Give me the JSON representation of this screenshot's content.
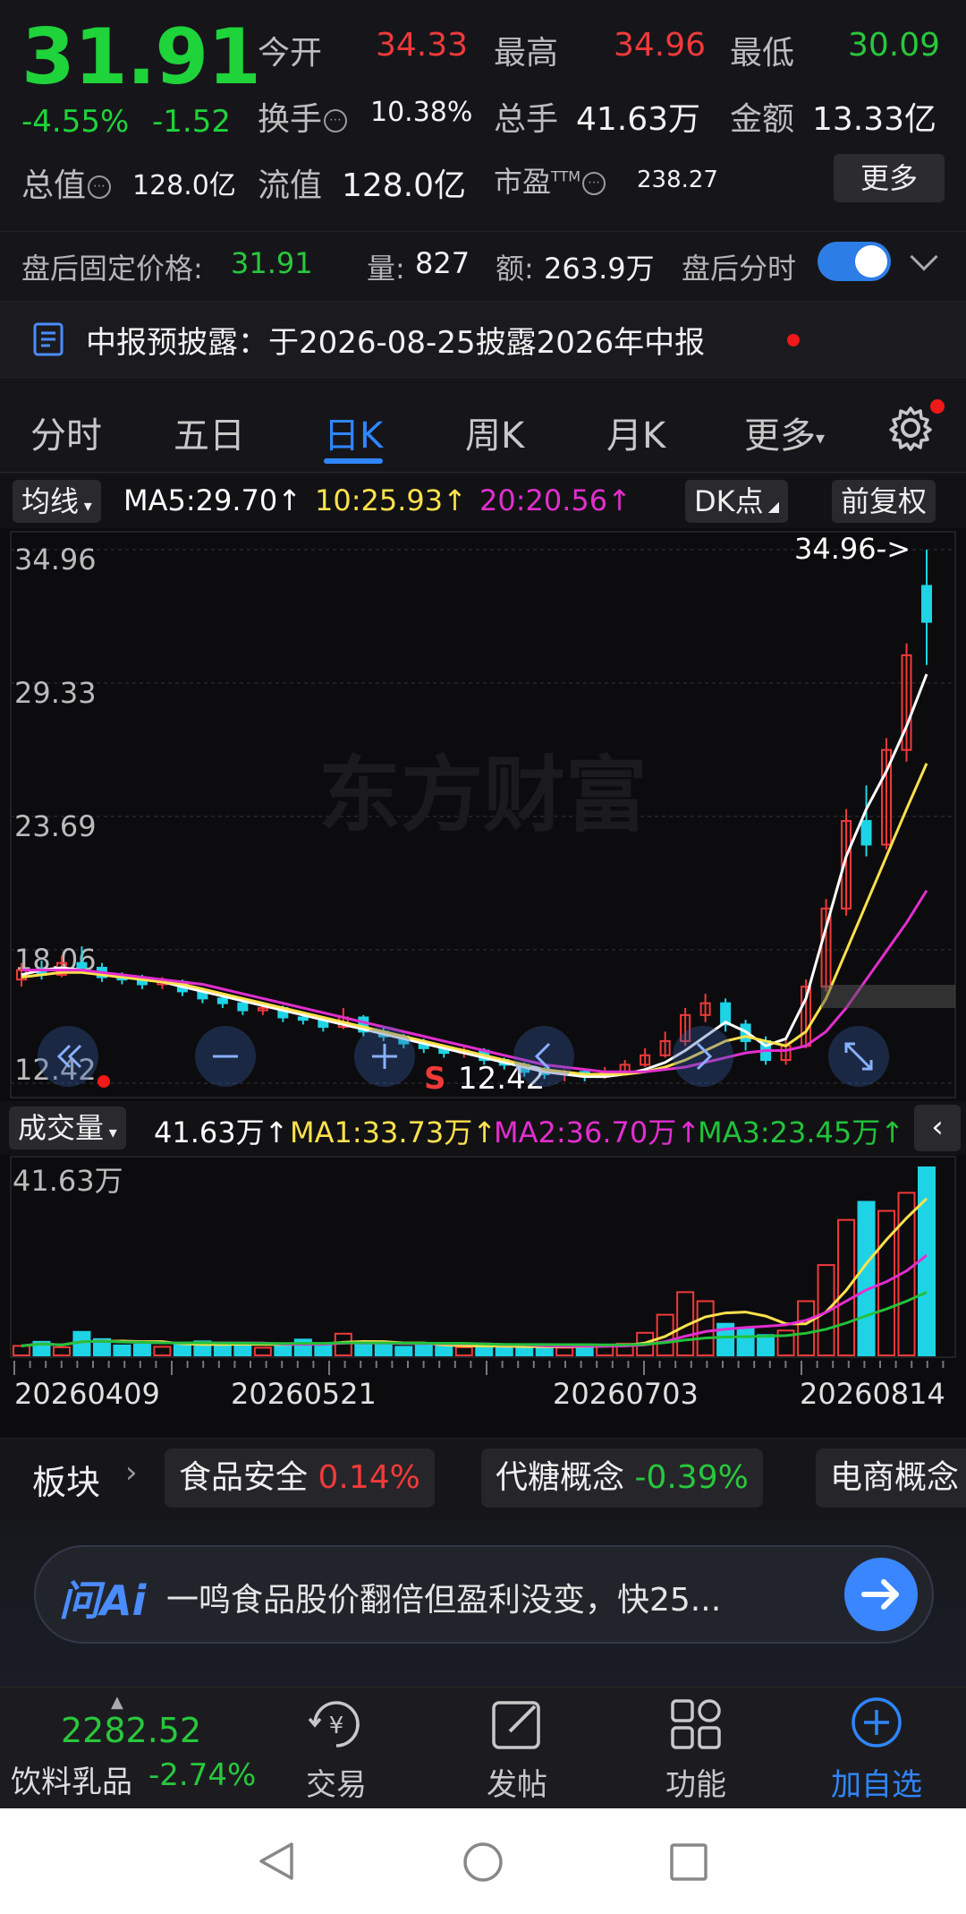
{
  "quote": {
    "price": "31.91",
    "change_pct": "-4.55%",
    "change_abs": "-1.52",
    "open_label": "今开",
    "open_value": "34.33",
    "high_label": "最高",
    "high_value": "34.96",
    "low_label": "最低",
    "low_value": "30.09",
    "turnover_label": "换手",
    "turnover_value": "10.38%",
    "volume_label": "总手",
    "volume_value": "41.63万",
    "amount_label": "金额",
    "amount_value": "13.33亿",
    "mktcap_label": "总值",
    "mktcap_value": "128.0亿",
    "float_label": "流值",
    "float_value": "128.0亿",
    "pe_label": "市盈",
    "pe_super": "TTM",
    "pe_value": "238.27",
    "more_label": "更多"
  },
  "after_hours": {
    "fixed_label": "盘后固定价格:",
    "fixed_value": "31.91",
    "vol_label": "量:",
    "vol_value": "827",
    "amt_label": "额:",
    "amt_value": "263.9万",
    "timeshare_label": "盘后分时",
    "toggle_on": true
  },
  "notice": {
    "text": "中报预披露：于2026-08-25披露2026年中报"
  },
  "tabs": [
    {
      "label": "分时",
      "active": false
    },
    {
      "label": "五日",
      "active": false
    },
    {
      "label": "日K",
      "active": true
    },
    {
      "label": "周K",
      "active": false
    },
    {
      "label": "月K",
      "active": false
    },
    {
      "label": "更多",
      "active": false
    }
  ],
  "ma_header": {
    "selector": "均线",
    "ma5": "MA5:29.70↑",
    "ma10": "10:25.93↑",
    "ma20": "20:20.56↑",
    "dk": "DK点",
    "adjust": "前复权"
  },
  "colors": {
    "up": "#f03a3a",
    "down": "#1fd3e6",
    "ma5": "#ffffff",
    "ma10": "#ffe14d",
    "ma20": "#e22ed0",
    "accent": "#2f86ff"
  },
  "chart_data": [
    {
      "type": "candlestick",
      "y_ticks": [
        "34.96",
        "29.33",
        "23.69",
        "18.06",
        "12.42"
      ],
      "ylim": [
        12.42,
        34.96
      ],
      "max_label": "34.96->",
      "min_label": "12.42",
      "signal_label": "S",
      "watermark": "东方财富",
      "series": [
        {
          "name": "MA5",
          "values": [
            17.0,
            17.2,
            17.3,
            17.2,
            17.0,
            16.9,
            16.8,
            16.7,
            16.5,
            16.3,
            16.1,
            15.9,
            15.7,
            15.5,
            15.3,
            15.1,
            14.9,
            14.7,
            14.5,
            14.3,
            14.1,
            13.9,
            13.7,
            13.5,
            13.3,
            13.1,
            12.9,
            12.8,
            12.7,
            12.7,
            12.8,
            13.0,
            13.3,
            13.8,
            14.4,
            15.0,
            14.6,
            14.0,
            14.3,
            16.0,
            19.0,
            22.0,
            24.0,
            25.6,
            27.5,
            29.7
          ]
        },
        {
          "name": "MA10",
          "values": [
            16.9,
            17.0,
            17.1,
            17.1,
            17.0,
            16.9,
            16.8,
            16.7,
            16.6,
            16.4,
            16.2,
            16.0,
            15.8,
            15.6,
            15.4,
            15.2,
            15.0,
            14.8,
            14.6,
            14.4,
            14.2,
            14.0,
            13.8,
            13.6,
            13.4,
            13.2,
            13.0,
            12.9,
            12.8,
            12.8,
            12.8,
            12.9,
            13.1,
            13.4,
            13.8,
            14.2,
            14.4,
            14.2,
            14.0,
            14.6,
            16.0,
            18.0,
            20.0,
            22.0,
            24.0,
            25.93
          ]
        },
        {
          "name": "MA20",
          "values": [
            17.2,
            17.2,
            17.2,
            17.2,
            17.1,
            17.0,
            16.9,
            16.8,
            16.7,
            16.6,
            16.4,
            16.2,
            16.0,
            15.8,
            15.6,
            15.4,
            15.2,
            15.0,
            14.8,
            14.6,
            14.4,
            14.2,
            14.0,
            13.8,
            13.6,
            13.4,
            13.2,
            13.1,
            13.0,
            12.9,
            12.9,
            12.9,
            13.0,
            13.1,
            13.3,
            13.5,
            13.7,
            13.8,
            13.8,
            14.0,
            14.6,
            15.6,
            16.8,
            18.0,
            19.2,
            20.56
          ]
        }
      ],
      "candles": [
        {
          "o": 16.8,
          "c": 17.2,
          "h": 17.5,
          "l": 16.5
        },
        {
          "o": 17.2,
          "c": 17.0,
          "h": 17.6,
          "l": 16.8
        },
        {
          "o": 17.0,
          "c": 17.5,
          "h": 17.8,
          "l": 16.9
        },
        {
          "o": 17.5,
          "c": 17.3,
          "h": 18.2,
          "l": 17.1
        },
        {
          "o": 17.3,
          "c": 16.9,
          "h": 17.5,
          "l": 16.7
        },
        {
          "o": 16.9,
          "c": 16.8,
          "h": 17.1,
          "l": 16.6
        },
        {
          "o": 16.8,
          "c": 16.6,
          "h": 17.0,
          "l": 16.4
        },
        {
          "o": 16.6,
          "c": 16.7,
          "h": 16.9,
          "l": 16.4
        },
        {
          "o": 16.7,
          "c": 16.3,
          "h": 16.8,
          "l": 16.1
        },
        {
          "o": 16.3,
          "c": 16.0,
          "h": 16.4,
          "l": 15.8
        },
        {
          "o": 16.0,
          "c": 15.8,
          "h": 16.2,
          "l": 15.6
        },
        {
          "o": 15.8,
          "c": 15.5,
          "h": 15.9,
          "l": 15.3
        },
        {
          "o": 15.5,
          "c": 15.6,
          "h": 15.8,
          "l": 15.3
        },
        {
          "o": 15.6,
          "c": 15.2,
          "h": 15.7,
          "l": 15.0
        },
        {
          "o": 15.2,
          "c": 15.1,
          "h": 15.4,
          "l": 14.9
        },
        {
          "o": 15.1,
          "c": 14.8,
          "h": 15.2,
          "l": 14.6
        },
        {
          "o": 14.8,
          "c": 15.2,
          "h": 15.6,
          "l": 14.7
        },
        {
          "o": 15.2,
          "c": 14.6,
          "h": 15.3,
          "l": 14.4
        },
        {
          "o": 14.6,
          "c": 14.4,
          "h": 14.8,
          "l": 14.2
        },
        {
          "o": 14.4,
          "c": 14.1,
          "h": 14.5,
          "l": 13.9
        },
        {
          "o": 14.1,
          "c": 13.9,
          "h": 14.3,
          "l": 13.7
        },
        {
          "o": 13.9,
          "c": 13.7,
          "h": 14.0,
          "l": 13.5
        },
        {
          "o": 13.7,
          "c": 13.8,
          "h": 14.0,
          "l": 13.5
        },
        {
          "o": 13.8,
          "c": 13.4,
          "h": 13.9,
          "l": 13.2
        },
        {
          "o": 13.4,
          "c": 13.2,
          "h": 13.5,
          "l": 13.0
        },
        {
          "o": 13.2,
          "c": 12.9,
          "h": 13.3,
          "l": 12.7
        },
        {
          "o": 12.9,
          "c": 12.8,
          "h": 13.1,
          "l": 12.6
        },
        {
          "o": 12.8,
          "c": 12.9,
          "h": 13.0,
          "l": 12.5
        },
        {
          "o": 12.9,
          "c": 12.7,
          "h": 13.0,
          "l": 12.5
        },
        {
          "o": 12.7,
          "c": 12.9,
          "h": 13.1,
          "l": 12.6
        },
        {
          "o": 12.9,
          "c": 13.2,
          "h": 13.4,
          "l": 12.8
        },
        {
          "o": 13.2,
          "c": 13.6,
          "h": 13.9,
          "l": 13.1
        },
        {
          "o": 13.6,
          "c": 14.2,
          "h": 14.6,
          "l": 13.5
        },
        {
          "o": 14.2,
          "c": 15.3,
          "h": 15.6,
          "l": 14.0
        },
        {
          "o": 15.3,
          "c": 15.8,
          "h": 16.2,
          "l": 15.0
        },
        {
          "o": 15.8,
          "c": 14.9,
          "h": 16.0,
          "l": 14.6
        },
        {
          "o": 14.9,
          "c": 14.2,
          "h": 15.1,
          "l": 13.8
        },
        {
          "o": 14.2,
          "c": 13.4,
          "h": 14.4,
          "l": 13.2
        },
        {
          "o": 13.4,
          "c": 14.0,
          "h": 14.3,
          "l": 13.2
        },
        {
          "o": 14.0,
          "c": 16.5,
          "h": 16.8,
          "l": 13.9
        },
        {
          "o": 16.5,
          "c": 19.8,
          "h": 20.2,
          "l": 16.3
        },
        {
          "o": 19.8,
          "c": 23.5,
          "h": 24.0,
          "l": 19.5
        },
        {
          "o": 23.5,
          "c": 22.5,
          "h": 25.0,
          "l": 22.0
        },
        {
          "o": 22.5,
          "c": 26.5,
          "h": 27.0,
          "l": 22.3
        },
        {
          "o": 26.5,
          "c": 30.5,
          "h": 31.0,
          "l": 26.0
        },
        {
          "o": 33.43,
          "c": 31.91,
          "h": 34.96,
          "l": 30.09
        }
      ]
    },
    {
      "type": "bar",
      "title": "成交量",
      "current": "41.63万↑",
      "ma1": "MA1:33.73万↑",
      "ma2": "MA2:36.70万↑",
      "ma3": "MA3:23.45万↑",
      "y_top_label": "41.63万",
      "x_dates": [
        "20260409",
        "20260521",
        "20260703",
        "20260814"
      ],
      "values": [
        2.1,
        3.0,
        1.8,
        5.2,
        3.6,
        2.2,
        2.4,
        1.9,
        2.6,
        3.1,
        2.0,
        2.8,
        1.7,
        2.4,
        3.5,
        2.1,
        4.8,
        2.6,
        2.3,
        1.9,
        2.2,
        2.5,
        1.8,
        2.0,
        1.6,
        1.9,
        2.2,
        1.7,
        2.4,
        2.0,
        2.6,
        5.0,
        9.0,
        14.0,
        12.0,
        7.0,
        6.0,
        4.5,
        5.5,
        12.0,
        20.0,
        30.0,
        34.0,
        32.0,
        36.0,
        41.63
      ]
    }
  ],
  "sectors": {
    "label": "板块",
    "items": [
      {
        "name": "食品安全",
        "pct": "0.14%",
        "up": true
      },
      {
        "name": "代糖概念",
        "pct": "-0.39%",
        "up": false
      },
      {
        "name": "电商概念",
        "pct": "",
        "up": true
      }
    ]
  },
  "ai": {
    "logo": "问Ai",
    "prompt": "一鸣食品股价翻倍但盈利没变，快25..."
  },
  "bottom_nav": {
    "index_value": "2282.52",
    "index_name": "饮料乳品",
    "index_pct": "-2.74%",
    "items": [
      {
        "label": "交易"
      },
      {
        "label": "发帖"
      },
      {
        "label": "功能"
      },
      {
        "label": "加自选"
      }
    ]
  }
}
